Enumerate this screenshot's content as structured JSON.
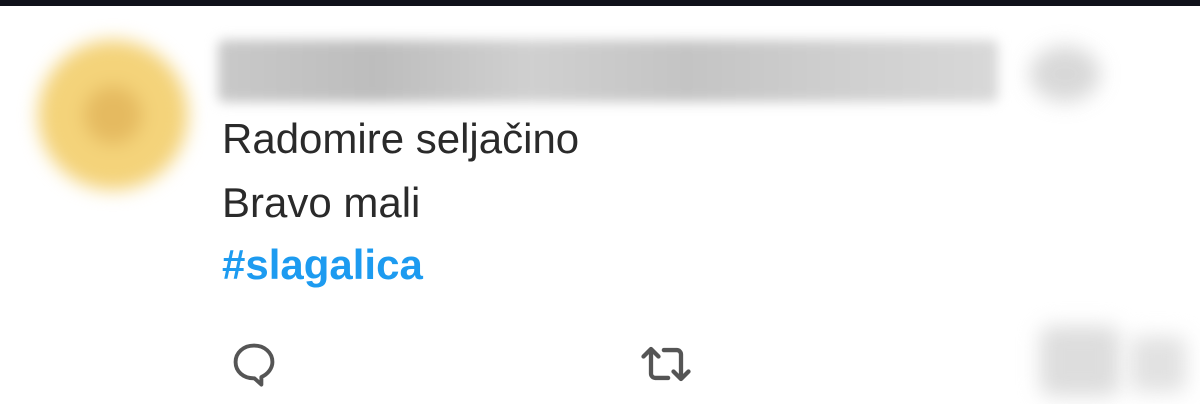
{
  "colors": {
    "top_bar": "#10111a",
    "text": "#2a2a2a",
    "hashtag": "#1d9bf0",
    "icon": "#555555",
    "avatar_outer": "#f4d37a",
    "avatar_center": "#d9a64a"
  },
  "tweet": {
    "lines": [
      "Radomire seljačino",
      "Bravo mali"
    ],
    "hashtag": "#slagalica",
    "author_redacted": true
  },
  "actions": {
    "reply_icon": "reply-icon",
    "retweet_icon": "retweet-icon"
  }
}
